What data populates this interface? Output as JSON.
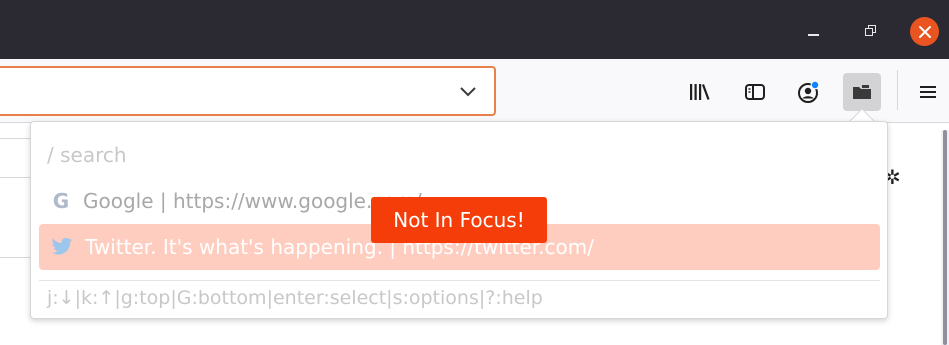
{
  "window": {
    "icons": {
      "minimize": "minimize-icon",
      "maximize": "maximize-icon",
      "close": "close-icon"
    },
    "close_color": "#e95420"
  },
  "toolbar": {
    "url_value": "",
    "icons": [
      "library-icon",
      "sidebar-icon",
      "account-icon",
      "extension-icon",
      "hamburger-menu-icon"
    ],
    "urlbar_focus_color": "#e8804b"
  },
  "popup": {
    "search_placeholder": "/ search",
    "results": [
      {
        "icon": "google-icon",
        "text": "Google | https://www.google.com/",
        "highlighted": false
      },
      {
        "icon": "twitter-icon",
        "text": "Twitter. It's what's happening. | https://twitter.com/",
        "highlighted": true
      }
    ],
    "help_text": "j:↓|k:↑|g:top|G:bottom|enter:select|s:options|?:help",
    "highlight_color": "#ffcdbf"
  },
  "badge": {
    "text": "Not In Focus!",
    "color": "#f53d0a"
  },
  "page": {
    "glyph": "✲"
  }
}
